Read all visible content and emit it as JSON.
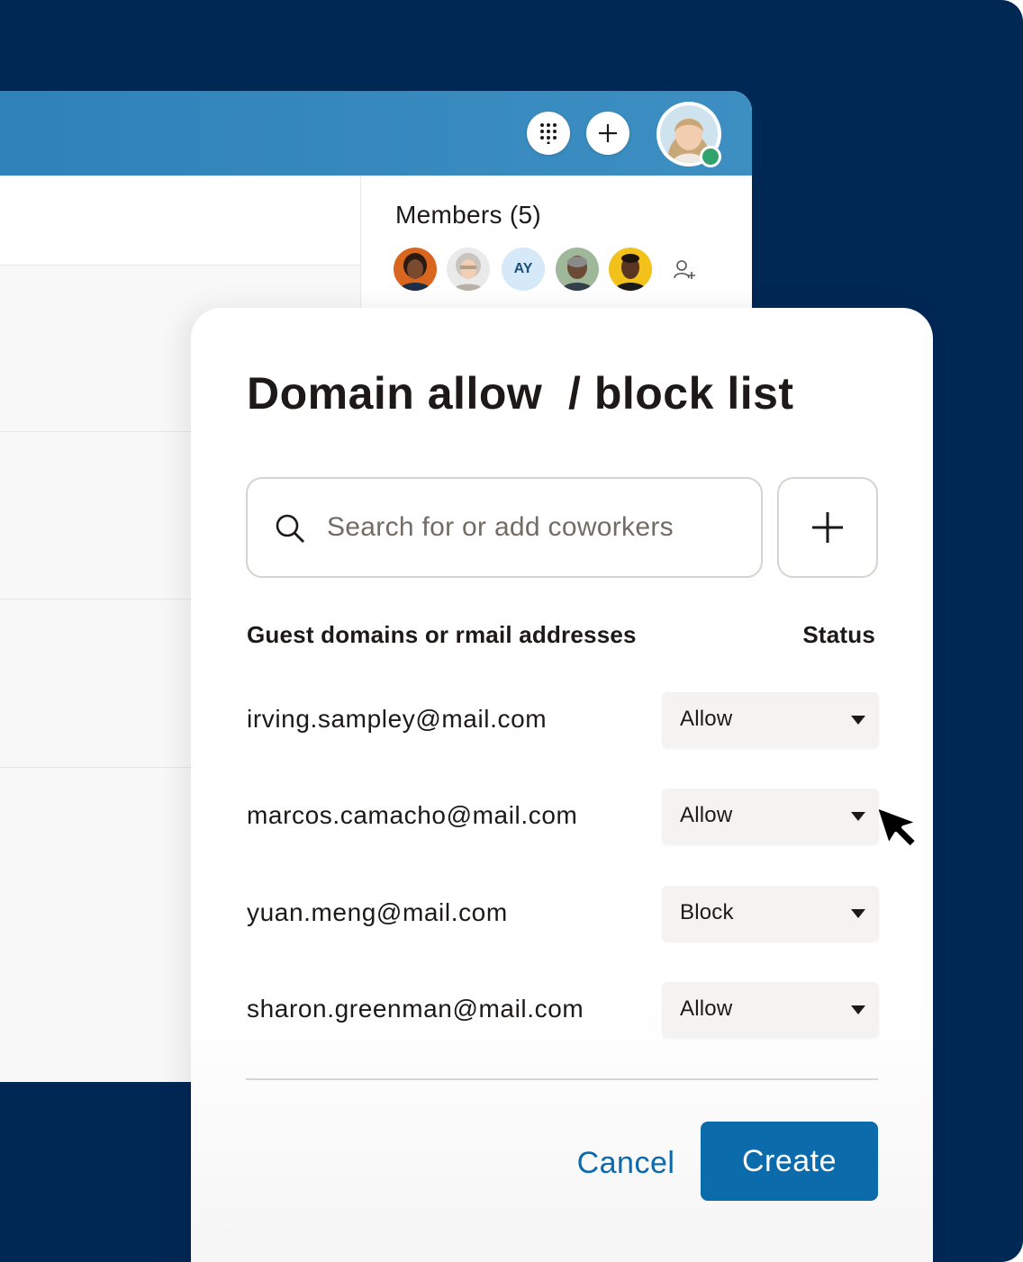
{
  "app": {
    "members_title": "Members (5)",
    "member_initials": "AY"
  },
  "modal": {
    "title": "Domain allow  / block list",
    "search": {
      "placeholder": "Search for or add coworkers",
      "value": ""
    },
    "columns": {
      "domains": "Guest domains or rmail addresses",
      "status": "Status"
    },
    "rows": [
      {
        "email": "irving.sampley@mail.com",
        "status": "Allow"
      },
      {
        "email": "marcos.camacho@mail.com",
        "status": "Allow"
      },
      {
        "email": "yuan.meng@mail.com",
        "status": "Block"
      },
      {
        "email": "sharon.greenman@mail.com",
        "status": "Allow"
      }
    ],
    "cancel_label": "Cancel",
    "create_label": "Create"
  },
  "colors": {
    "background": "#002855",
    "header": "#3d8fc2",
    "primary": "#0b6bab",
    "presence": "#2fa36b"
  },
  "icons": [
    "app-grid-icon",
    "plus-icon",
    "user-avatar",
    "add-member-icon",
    "search-icon",
    "add-plus-icon",
    "caret-down-icon",
    "mouse-pointer-icon"
  ]
}
